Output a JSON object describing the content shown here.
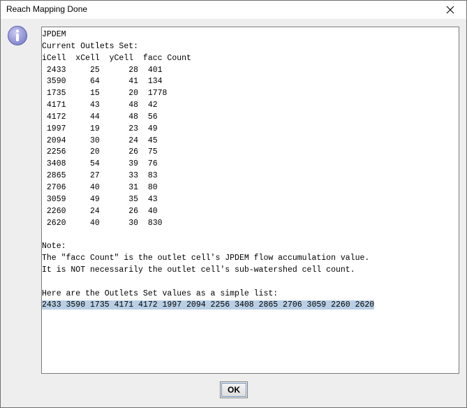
{
  "window": {
    "title": "Reach Mapping Done"
  },
  "icons": {
    "info": "info-icon",
    "close": "close-icon"
  },
  "message": {
    "header_lines": [
      "JPDEM",
      "Current Outlets Set:",
      "iCell  xCell  yCell  facc Count"
    ],
    "rows": [
      {
        "iCell": "2433",
        "xCell": "25",
        "yCell": "28",
        "facc": "401"
      },
      {
        "iCell": "3590",
        "xCell": "64",
        "yCell": "41",
        "facc": "134"
      },
      {
        "iCell": "1735",
        "xCell": "15",
        "yCell": "20",
        "facc": "1778"
      },
      {
        "iCell": "4171",
        "xCell": "43",
        "yCell": "48",
        "facc": "42"
      },
      {
        "iCell": "4172",
        "xCell": "44",
        "yCell": "48",
        "facc": "56"
      },
      {
        "iCell": "1997",
        "xCell": "19",
        "yCell": "23",
        "facc": "49"
      },
      {
        "iCell": "2094",
        "xCell": "30",
        "yCell": "24",
        "facc": "45"
      },
      {
        "iCell": "2256",
        "xCell": "20",
        "yCell": "26",
        "facc": "75"
      },
      {
        "iCell": "3408",
        "xCell": "54",
        "yCell": "39",
        "facc": "76"
      },
      {
        "iCell": "2865",
        "xCell": "27",
        "yCell": "33",
        "facc": "83"
      },
      {
        "iCell": "2706",
        "xCell": "40",
        "yCell": "31",
        "facc": "80"
      },
      {
        "iCell": "3059",
        "xCell": "49",
        "yCell": "35",
        "facc": "43"
      },
      {
        "iCell": "2260",
        "xCell": "24",
        "yCell": "26",
        "facc": "40"
      },
      {
        "iCell": "2620",
        "xCell": "40",
        "yCell": "30",
        "facc": "830"
      }
    ],
    "note_lines": [
      "Note:",
      "The \"facc Count\" is the outlet cell's JPDEM flow accumulation value.",
      "It is NOT necessarily the outlet cell's sub-watershed cell count."
    ],
    "list_intro": "Here are the Outlets Set values as a simple list:",
    "list_values": "2433 3590 1735 4171 4172 1997 2094 2256 3408 2865 2706 3059 2260 2620"
  },
  "buttons": {
    "ok_label": "OK"
  },
  "colors": {
    "selection": "#b8cfe5",
    "info_icon_fill": "#8a8fd6"
  }
}
